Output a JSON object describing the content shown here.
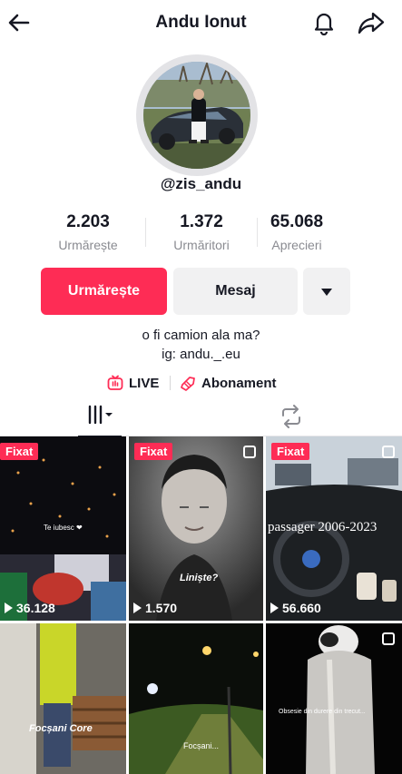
{
  "header": {
    "title": "Andu Ionut",
    "back_icon": "arrow-left-icon",
    "notification_icon": "bell-icon",
    "share_icon": "share-arrow-icon"
  },
  "profile": {
    "username": "@zis_andu",
    "stats": [
      {
        "value": "2.203",
        "label": "Urmărește"
      },
      {
        "value": "1.372",
        "label": "Urmăritori"
      },
      {
        "value": "65.068",
        "label": "Aprecieri"
      }
    ],
    "buttons": {
      "follow": "Urmărește",
      "message": "Mesaj",
      "more_icon": "caret-down-icon"
    },
    "bio": [
      "o fi camion ala ma?",
      "ig: andu._.eu"
    ],
    "links": {
      "live": "LIVE",
      "subscription": "Abonament"
    }
  },
  "tabs": {
    "videos_icon": "grid-icon",
    "reposts_icon": "repost-icon"
  },
  "videos": [
    {
      "pinned": "Fixat",
      "views": "36.128",
      "caption": "Te iubesc ❤"
    },
    {
      "pinned": "Fixat",
      "views": "1.570",
      "caption": "Liniște?"
    },
    {
      "pinned": "Fixat",
      "views": "56.660",
      "caption": "passager 2006-2023"
    },
    {
      "caption": "Focșani Core"
    },
    {
      "caption": "Focșani..."
    },
    {
      "caption": "Obsesie din durere din trecut..."
    }
  ],
  "colors": {
    "accent": "#fe2c55",
    "text": "#161823",
    "muted": "#8a8b91",
    "button_gray": "#f1f1f2"
  }
}
